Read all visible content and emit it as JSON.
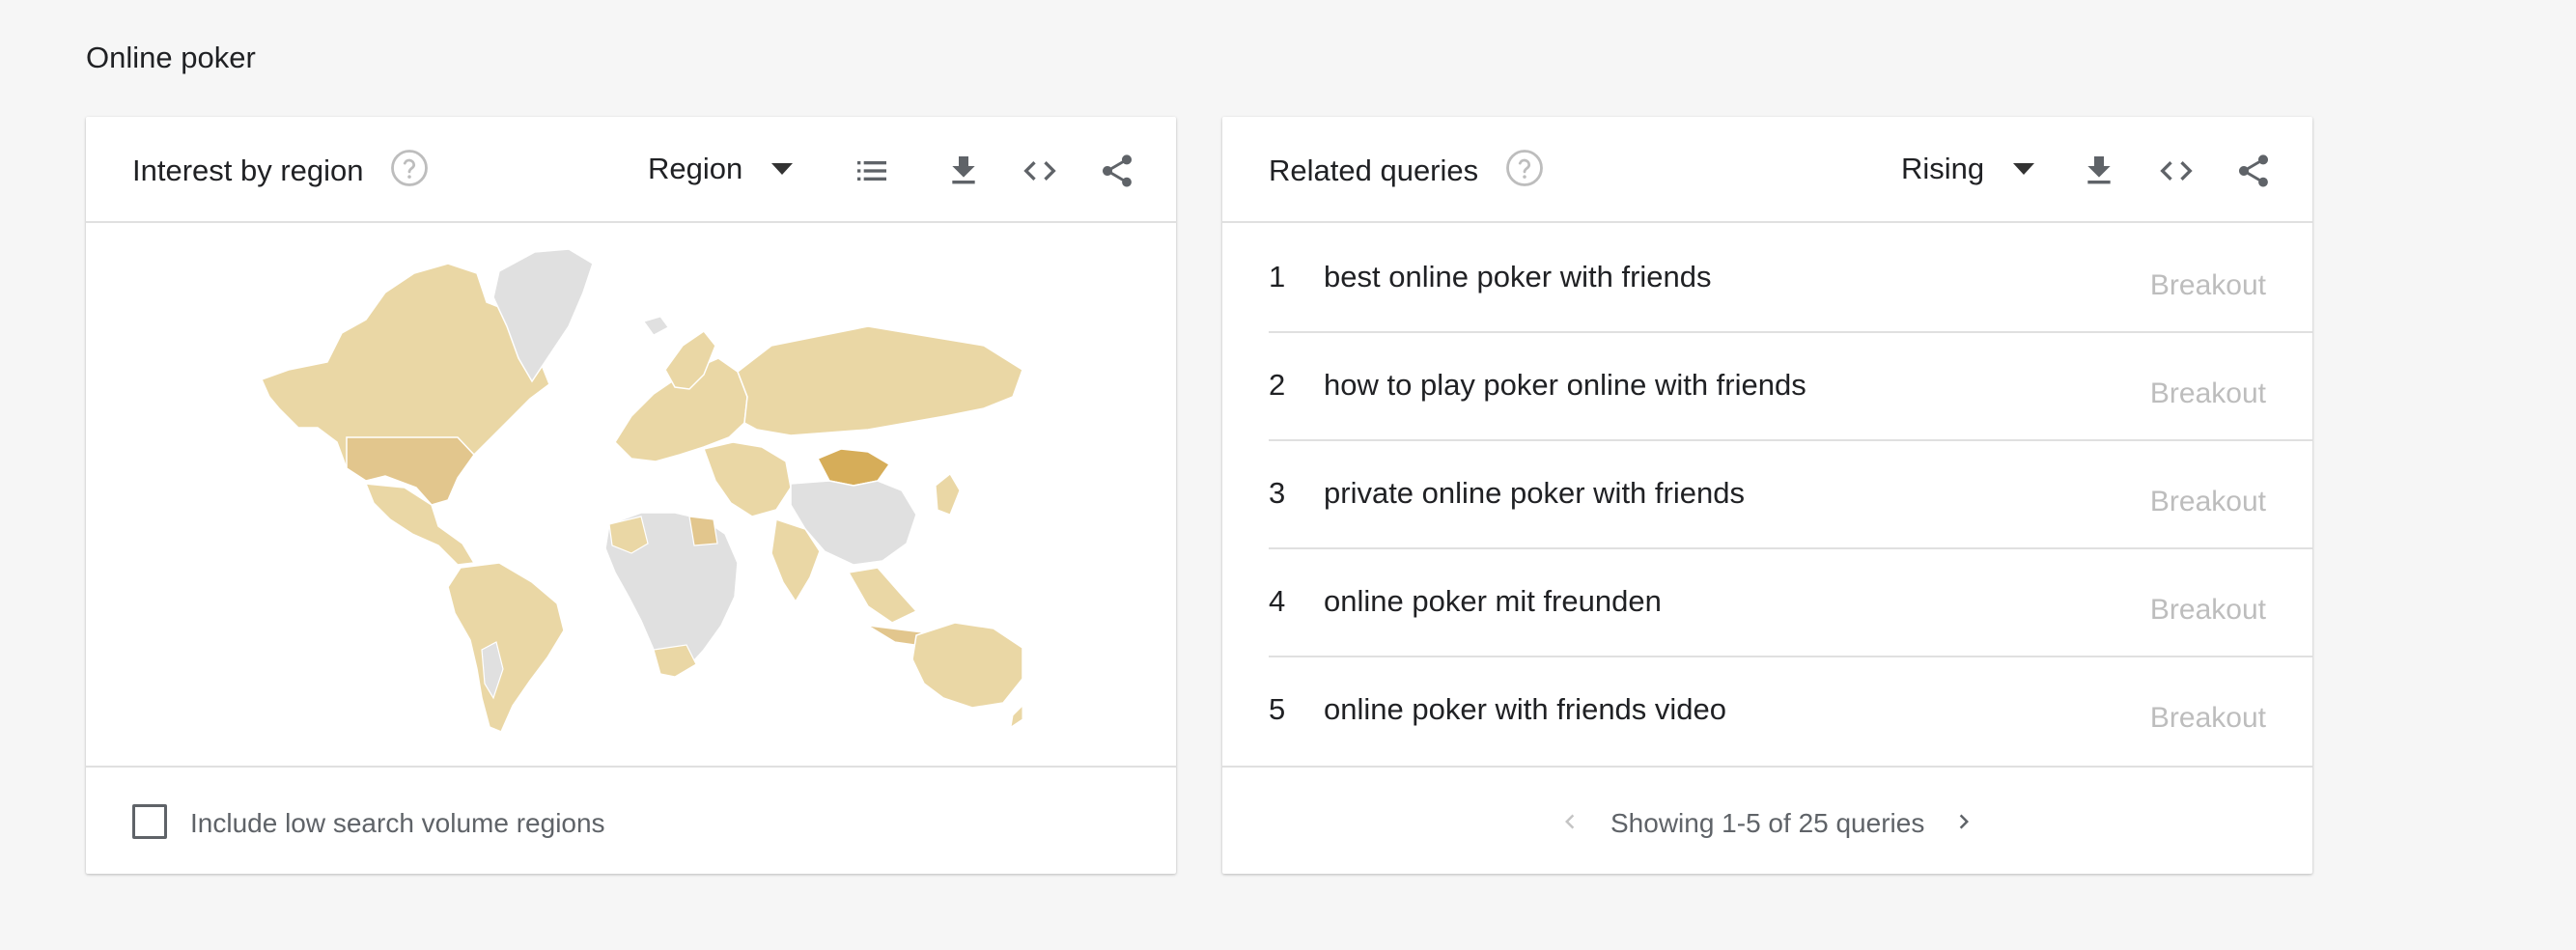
{
  "page": {
    "title": "Online poker"
  },
  "interest_by_region": {
    "title": "Interest by region",
    "help_icon": "help-circle-icon",
    "resolution": "Region",
    "tools": [
      "list-icon",
      "download-icon",
      "embed-code-icon",
      "share-icon"
    ],
    "include_low_volume_label": "Include low search volume regions",
    "include_low_volume_checked": false,
    "colors": {
      "low": "#ead7a5",
      "high": "#d6ad59",
      "no_data": "#e0e0e0"
    }
  },
  "related_queries": {
    "title": "Related queries",
    "help_icon": "help-circle-icon",
    "sort": "Rising",
    "tools": [
      "download-icon",
      "embed-code-icon",
      "share-icon"
    ],
    "rows": [
      {
        "rank": "1",
        "query": "best online poker with friends",
        "value": "Breakout"
      },
      {
        "rank": "2",
        "query": "how to play poker online with friends",
        "value": "Breakout"
      },
      {
        "rank": "3",
        "query": "private online poker with friends",
        "value": "Breakout"
      },
      {
        "rank": "4",
        "query": "online poker mit freunden",
        "value": "Breakout"
      },
      {
        "rank": "5",
        "query": "online poker with friends video",
        "value": "Breakout"
      }
    ],
    "pagination": "Showing 1-5 of 25 queries"
  }
}
